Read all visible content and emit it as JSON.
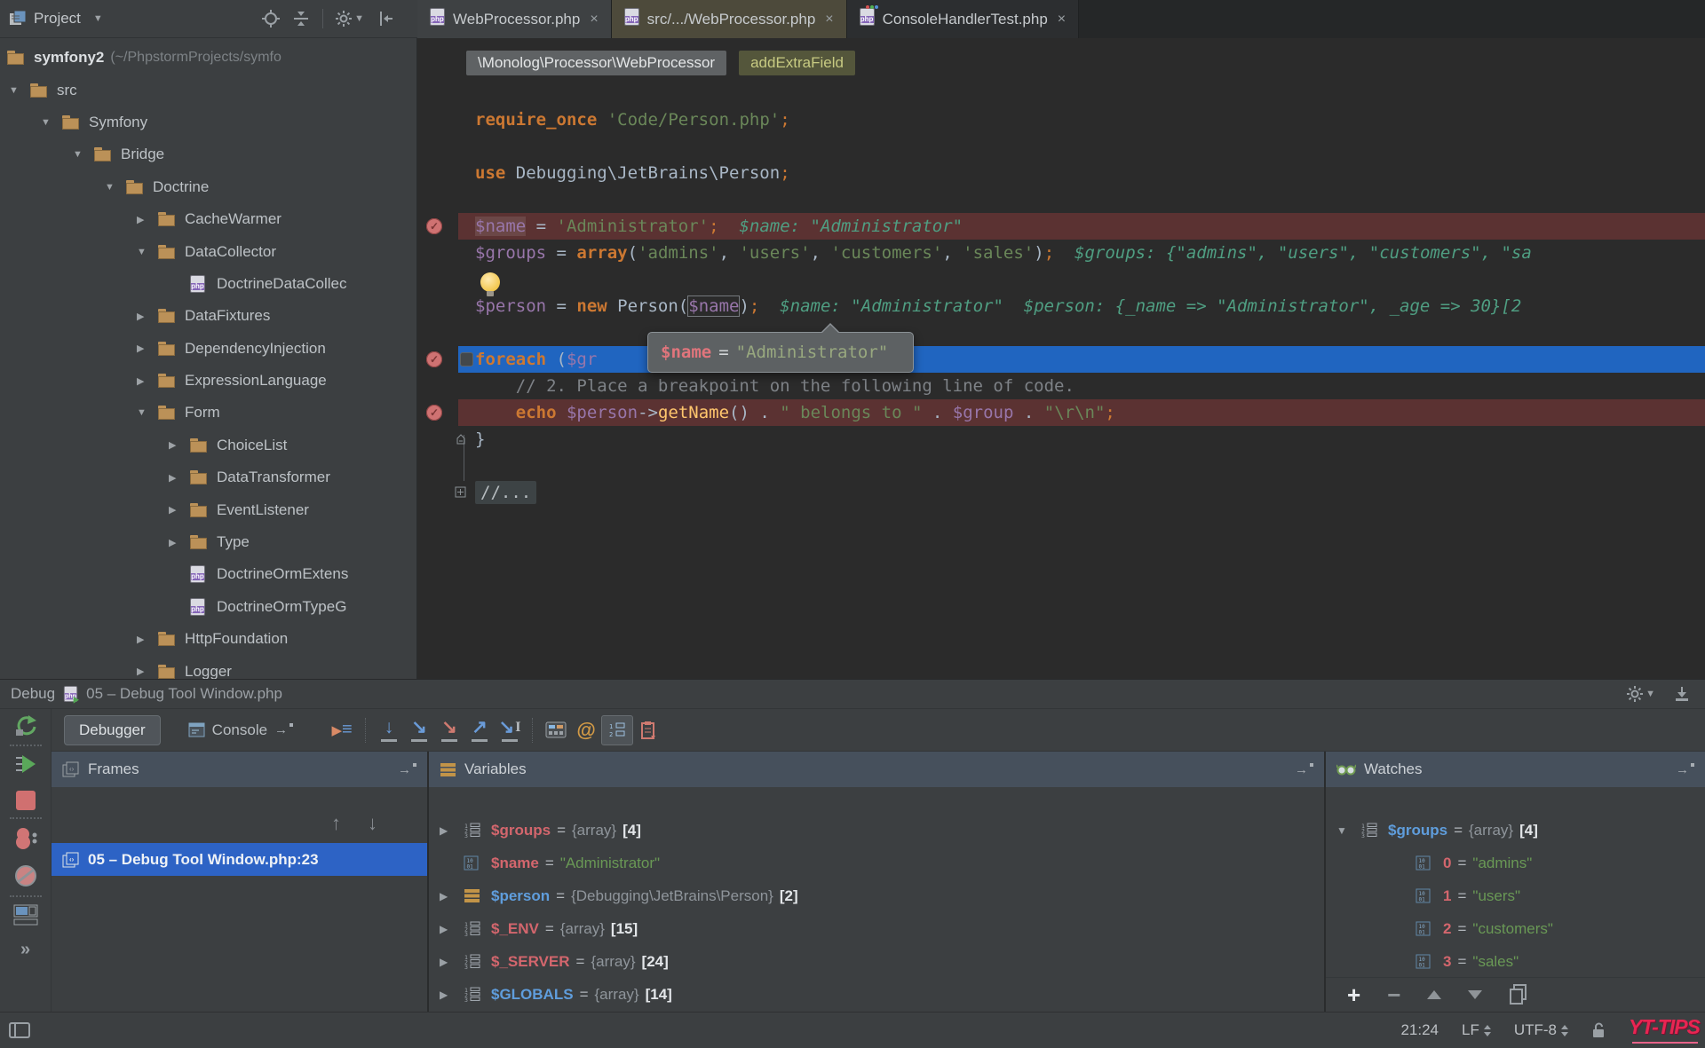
{
  "top_bar": {
    "project_label": "Project",
    "tabs": [
      {
        "label": "WebProcessor.php",
        "state": "normal"
      },
      {
        "label": "src/.../WebProcessor.php",
        "state": "active"
      },
      {
        "label": "ConsoleHandlerTest.php",
        "state": "dark",
        "dots": true
      }
    ]
  },
  "breadcrumbs": {
    "class_chip": "\\Monolog\\Processor\\WebProcessor",
    "method_chip": "addExtraField"
  },
  "project_tree": {
    "items": [
      {
        "level": 0,
        "icon": "folder",
        "label": "symfony2",
        "path": "(~/PhpstormProjects/symfo",
        "root": true
      },
      {
        "level": 1,
        "arrow": "down",
        "icon": "folder",
        "label": "src"
      },
      {
        "level": 2,
        "arrow": "down",
        "icon": "folder",
        "label": "Symfony"
      },
      {
        "level": 3,
        "arrow": "down",
        "icon": "folder",
        "label": "Bridge"
      },
      {
        "level": 4,
        "arrow": "down",
        "icon": "folder",
        "label": "Doctrine"
      },
      {
        "level": 5,
        "arrow": "right",
        "icon": "folder",
        "label": "CacheWarmer"
      },
      {
        "level": 5,
        "arrow": "down",
        "icon": "folder",
        "label": "DataCollector"
      },
      {
        "level": 6,
        "icon": "php",
        "label": "DoctrineDataCollec"
      },
      {
        "level": 5,
        "arrow": "right",
        "icon": "folder",
        "label": "DataFixtures"
      },
      {
        "level": 5,
        "arrow": "right",
        "icon": "folder",
        "label": "DependencyInjection"
      },
      {
        "level": 5,
        "arrow": "right",
        "icon": "folder",
        "label": "ExpressionLanguage"
      },
      {
        "level": 5,
        "arrow": "down",
        "icon": "folder",
        "label": "Form"
      },
      {
        "level": 6,
        "arrow": "right",
        "icon": "folder",
        "label": "ChoiceList"
      },
      {
        "level": 6,
        "arrow": "right",
        "icon": "folder",
        "label": "DataTransformer"
      },
      {
        "level": 6,
        "arrow": "right",
        "icon": "folder",
        "label": "EventListener"
      },
      {
        "level": 6,
        "arrow": "right",
        "icon": "folder",
        "label": "Type"
      },
      {
        "level": 6,
        "icon": "php",
        "label": "DoctrineOrmExtens"
      },
      {
        "level": 6,
        "icon": "php",
        "label": "DoctrineOrmTypeG"
      },
      {
        "level": 5,
        "arrow": "right",
        "icon": "folder",
        "label": "HttpFoundation"
      },
      {
        "level": 5,
        "arrow": "right",
        "icon": "folder",
        "label": "Logger"
      }
    ]
  },
  "editor": {
    "lines": [
      {
        "seg": []
      },
      {
        "seg": [
          {
            "c": "kw",
            "t": "require_once"
          },
          {
            "c": "pln",
            "t": " "
          },
          {
            "c": "str",
            "t": "'Code/Person.php'"
          },
          {
            "c": "semi",
            "t": ";"
          }
        ]
      },
      {
        "seg": []
      },
      {
        "seg": [
          {
            "c": "kw",
            "t": "use"
          },
          {
            "c": "pln",
            "t": " Debugging\\JetBrains\\Person"
          },
          {
            "c": "semi",
            "t": ";"
          }
        ]
      },
      {
        "seg": []
      },
      {
        "bg": "bp",
        "gutter": [
          "bp"
        ],
        "seg": [
          {
            "c": "var hlbg",
            "t": "$name"
          },
          {
            "c": "pln",
            "t": " = "
          },
          {
            "c": "str",
            "t": "'Administrator'"
          },
          {
            "c": "semi",
            "t": ";"
          },
          {
            "c": "hint",
            "t": "  $name: \"Administrator\""
          }
        ]
      },
      {
        "seg": [
          {
            "c": "var",
            "t": "$groups"
          },
          {
            "c": "pln",
            "t": " = "
          },
          {
            "c": "kw",
            "t": "array"
          },
          {
            "c": "pln",
            "t": "("
          },
          {
            "c": "str",
            "t": "'admins'"
          },
          {
            "c": "pln",
            "t": ", "
          },
          {
            "c": "str",
            "t": "'users'"
          },
          {
            "c": "pln",
            "t": ", "
          },
          {
            "c": "str",
            "t": "'customers'"
          },
          {
            "c": "pln",
            "t": ", "
          },
          {
            "c": "str",
            "t": "'sales'"
          },
          {
            "c": "pln",
            "t": ")"
          },
          {
            "c": "semi",
            "t": ";"
          },
          {
            "c": "hint",
            "t": "  $groups: {\"admins\", \"users\", \"customers\", \"sa"
          }
        ]
      },
      {
        "seg": []
      },
      {
        "seg": [
          {
            "c": "var",
            "t": "$person"
          },
          {
            "c": "pln",
            "t": " = "
          },
          {
            "c": "kw",
            "t": "new"
          },
          {
            "c": "pln",
            "t": " Person("
          },
          {
            "c": "var box",
            "t": "$name"
          },
          {
            "c": "pln",
            "t": ")"
          },
          {
            "c": "semi",
            "t": ";"
          },
          {
            "c": "hint",
            "t": "  $name: \"Administrator\"  $person: {_name => \"Administrator\", _age => 30}[2"
          }
        ]
      },
      {
        "seg": []
      },
      {
        "bg": "exec",
        "gutter": [
          "bp",
          "shield"
        ],
        "seg": [
          {
            "c": "kw",
            "t": "foreach"
          },
          {
            "c": "pln",
            "t": " ("
          },
          {
            "c": "var",
            "t": "$gr"
          }
        ]
      },
      {
        "seg": [
          {
            "c": "pln",
            "t": "    "
          },
          {
            "c": "cmt",
            "t": "// 2. Place a breakpoint on the following line of code."
          }
        ]
      },
      {
        "bg": "bp",
        "gutter": [
          "bp"
        ],
        "seg": [
          {
            "c": "pln",
            "t": "    "
          },
          {
            "c": "kw",
            "t": "echo"
          },
          {
            "c": "pln",
            "t": " "
          },
          {
            "c": "var",
            "t": "$person"
          },
          {
            "c": "op",
            "t": "->"
          },
          {
            "c": "fn",
            "t": "getName"
          },
          {
            "c": "pln",
            "t": "() "
          },
          {
            "c": "op",
            "t": "."
          },
          {
            "c": "pln",
            "t": " "
          },
          {
            "c": "str",
            "t": "\" belongs to \""
          },
          {
            "c": "pln",
            "t": " "
          },
          {
            "c": "op",
            "t": "."
          },
          {
            "c": "pln",
            "t": " "
          },
          {
            "c": "var",
            "t": "$group"
          },
          {
            "c": "pln",
            "t": " "
          },
          {
            "c": "op",
            "t": "."
          },
          {
            "c": "pln",
            "t": " "
          },
          {
            "c": "str",
            "t": "\"\\r\\n\""
          },
          {
            "c": "semi",
            "t": ";"
          }
        ]
      },
      {
        "gutter": [
          "fold-end"
        ],
        "seg": [
          {
            "c": "pln",
            "t": "}"
          }
        ]
      },
      {
        "seg": []
      },
      {
        "gutter": [
          "fold-plus"
        ],
        "seg": [
          {
            "c": "fold",
            "t": "//..."
          }
        ]
      }
    ],
    "tooltip": {
      "name": "$name",
      "eq": "=",
      "value": "\"Administrator\""
    }
  },
  "debug": {
    "header": {
      "tool_label": "Debug",
      "session_label": "05 – Debug Tool Window.php"
    },
    "toolbar": {
      "debugger_label": "Debugger",
      "console_label": "Console"
    },
    "frames": {
      "title": "Frames",
      "selected_frame": "05 – Debug Tool Window.php:23"
    },
    "variables": {
      "title": "Variables",
      "rows": [
        {
          "expand": true,
          "icon": "array",
          "name": "$groups",
          "color": "red",
          "value": "{array}",
          "count": "[4]"
        },
        {
          "expand": false,
          "icon": "primitive",
          "name": "$name",
          "color": "red",
          "string": "\"Administrator\""
        },
        {
          "expand": true,
          "icon": "object",
          "name": "$person",
          "color": "blue",
          "value": "{Debugging\\JetBrains\\Person}",
          "count": "[2]"
        },
        {
          "expand": true,
          "icon": "array",
          "name": "$_ENV",
          "color": "red",
          "value": "{array}",
          "count": "[15]"
        },
        {
          "expand": true,
          "icon": "array",
          "name": "$_SERVER",
          "color": "red",
          "value": "{array}",
          "count": "[24]"
        },
        {
          "expand": true,
          "icon": "array",
          "name": "$GLOBALS",
          "color": "blue",
          "value": "{array}",
          "count": "[14]"
        }
      ]
    },
    "watches": {
      "title": "Watches",
      "rows": [
        {
          "expand": "down",
          "icon": "array",
          "name": "$groups",
          "color": "blue",
          "value": "{array}",
          "count": "[4]"
        },
        {
          "child": true,
          "icon": "primitive",
          "name": "0",
          "color": "red",
          "string": "\"admins\""
        },
        {
          "child": true,
          "icon": "primitive",
          "name": "1",
          "color": "red",
          "string": "\"users\""
        },
        {
          "child": true,
          "icon": "primitive",
          "name": "2",
          "color": "red",
          "string": "\"customers\""
        },
        {
          "child": true,
          "icon": "primitive",
          "name": "3",
          "color": "red",
          "string": "\"sales\""
        }
      ]
    }
  },
  "status_bar": {
    "position": "21:24",
    "line_separator": "LF",
    "encoding": "UTF-8",
    "watermark": "YT-TIPS"
  }
}
